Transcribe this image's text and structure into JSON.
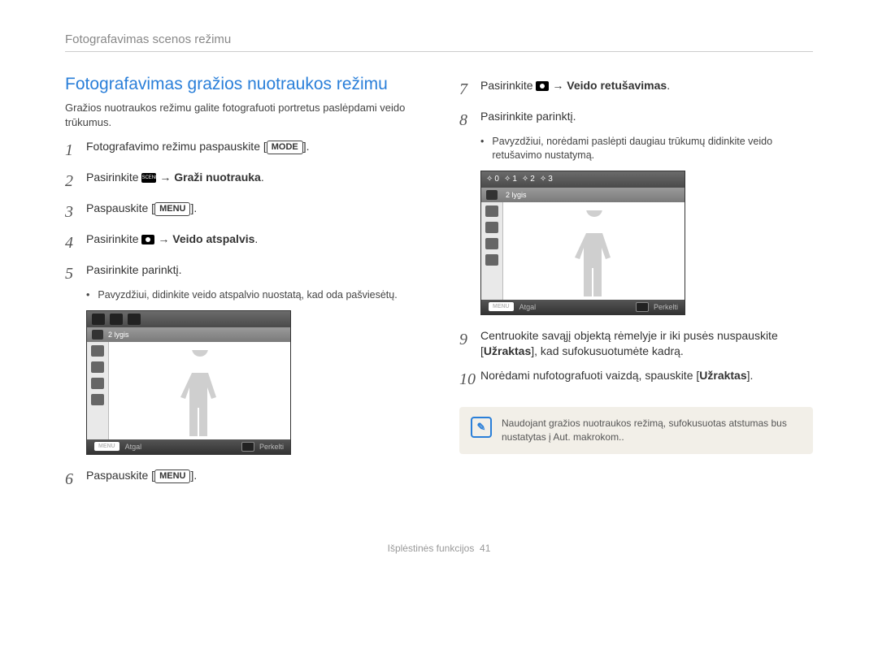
{
  "header": "Fotografavimas scenos režimu",
  "section_title": "Fotografavimas gražios nuotraukos režimu",
  "intro": "Gražios nuotraukos režimu galite fotografuoti portretus paslėpdami veido trūkumus.",
  "steps": {
    "s1": {
      "num": "1",
      "pre": "Fotografavimo režimu paspauskite [",
      "btn": "MODE",
      "post": "]."
    },
    "s2": {
      "num": "2",
      "pre": "Pasirinkite ",
      "arrow": " → ",
      "bold": "Graži nuotrauka",
      "post": "."
    },
    "s3": {
      "num": "3",
      "pre": "Paspauskite [",
      "btn": "MENU",
      "post": "]."
    },
    "s4": {
      "num": "4",
      "pre": "Pasirinkite ",
      "arrow": " → ",
      "bold": "Veido atspalvis",
      "post": "."
    },
    "s5": {
      "num": "5",
      "text": "Pasirinkite parinktį."
    },
    "s5sub": "Pavyzdžiui, didinkite veido atspalvio nuostatą, kad oda pašviesėtų.",
    "s6": {
      "num": "6",
      "pre": "Paspauskite [",
      "btn": "MENU",
      "post": "]."
    },
    "s7": {
      "num": "7",
      "pre": "Pasirinkite ",
      "arrow": " → ",
      "bold": "Veido retušavimas",
      "post": "."
    },
    "s8": {
      "num": "8",
      "text": "Pasirinkite parinktį."
    },
    "s8sub": "Pavyzdžiui, norėdami paslėpti daugiau trūkumų didinkite veido retušavimo nustatymą.",
    "s9": {
      "num": "9",
      "pre": "Centruokite savąjį objektą rėmelyje ir iki pusės nuspauskite [",
      "bold": "Užraktas",
      "post": "], kad sufokusuotumėte kadrą."
    },
    "s10": {
      "num": "10",
      "pre": "Norėdami nufotografuoti vaizdą, spauskite [",
      "bold": "Užraktas",
      "post": "]."
    }
  },
  "screen1": {
    "level": "2 lygis",
    "back": "Atgal",
    "move": "Perkelti",
    "menu_small": "MENU"
  },
  "screen2": {
    "level": "2 lygis",
    "back": "Atgal",
    "move": "Perkelti",
    "menu_small": "MENU",
    "fracs": [
      "0",
      "1",
      "2",
      "3"
    ]
  },
  "note": "Naudojant gražios nuotraukos režimą, sufokusuotas atstumas bus nustatytas į Aut. makrokom..",
  "footer": {
    "label": "Išplėstinės funkcijos",
    "page": "41"
  }
}
